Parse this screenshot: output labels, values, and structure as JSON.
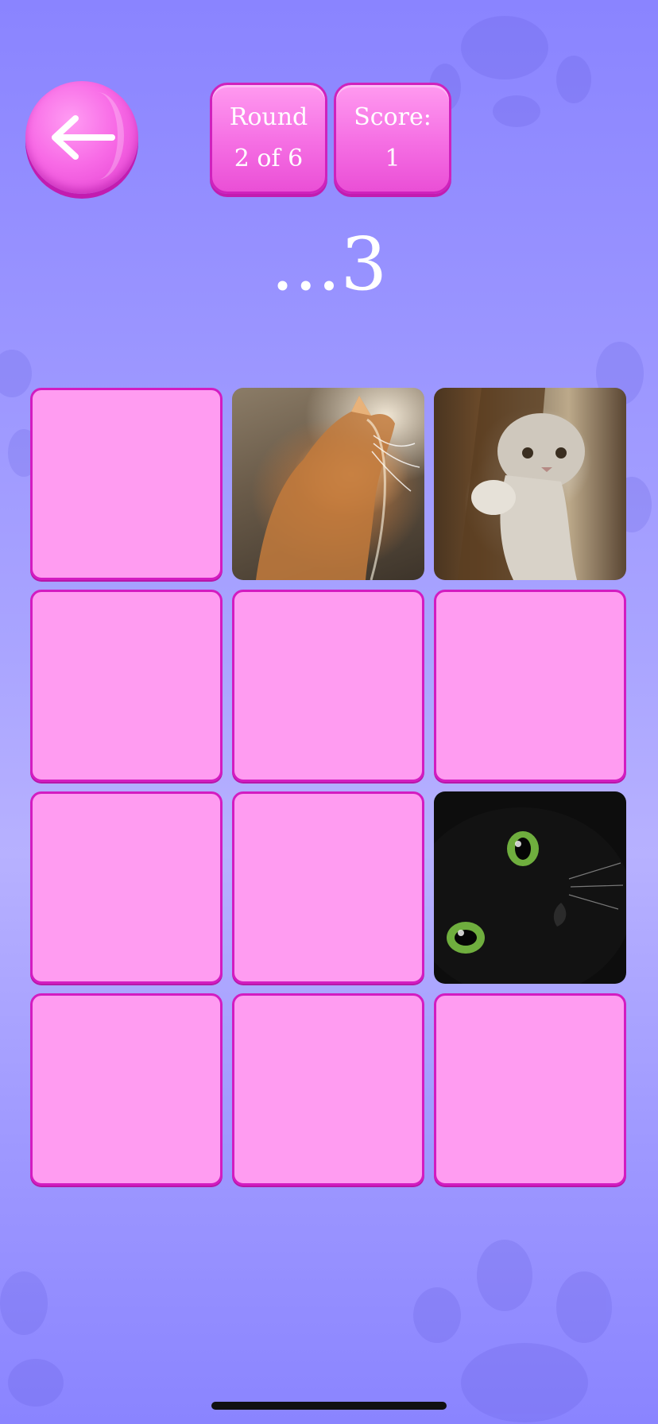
{
  "header": {
    "back_icon": "arrow-left-icon",
    "round_label": "Round",
    "round_value": "2 of 6",
    "score_label": "Score:",
    "score_value": "1"
  },
  "countdown": "...3",
  "board": {
    "rows": 4,
    "columns": 3,
    "cards": [
      {
        "state": "face-down"
      },
      {
        "state": "face-up",
        "image": "ginger-cat-photo"
      },
      {
        "state": "face-up",
        "image": "grey-cat-photo"
      },
      {
        "state": "face-down"
      },
      {
        "state": "face-down"
      },
      {
        "state": "face-down"
      },
      {
        "state": "face-down"
      },
      {
        "state": "face-down"
      },
      {
        "state": "face-up",
        "image": "black-cat-photo"
      },
      {
        "state": "face-down"
      },
      {
        "state": "face-down"
      },
      {
        "state": "face-down"
      }
    ]
  },
  "colors": {
    "background": "#a39eff",
    "button_pink": "#f56ee3",
    "card_back": "#ff9cf1",
    "card_border": "#d31cc1"
  }
}
